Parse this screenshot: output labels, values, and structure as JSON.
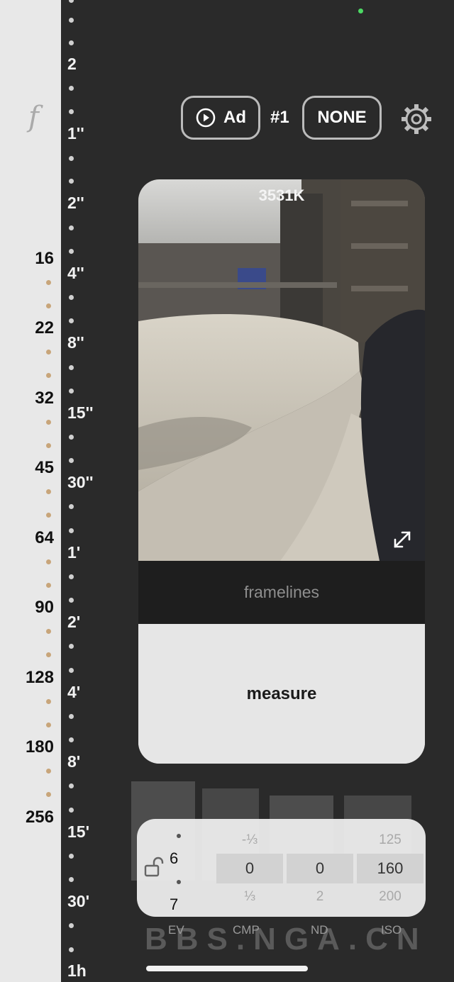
{
  "aperture": {
    "symbol": "f",
    "values": [
      "16",
      "22",
      "32",
      "45",
      "64",
      "90",
      "128",
      "180",
      "256"
    ]
  },
  "shutter": {
    "values": [
      "2",
      "1''",
      "2''",
      "4''",
      "8''",
      "15''",
      "30''",
      "1'",
      "2'",
      "4'",
      "8'",
      "15'",
      "30'",
      "1h"
    ]
  },
  "toolbar": {
    "ad_label": "Ad",
    "shot_number": "#1",
    "filter_label": "NONE"
  },
  "preview": {
    "white_balance": "3531K",
    "framelines_label": "framelines",
    "measure_label": "measure"
  },
  "exposure": {
    "ev_values": [
      "6",
      "7"
    ],
    "columns": [
      {
        "label": "CMP",
        "prev": "-⅓",
        "current": "0",
        "next": "⅓"
      },
      {
        "label": "ND",
        "prev": "",
        "current": "0",
        "next": "2"
      },
      {
        "label": "ISO",
        "prev": "125",
        "current": "160",
        "next": "200"
      }
    ],
    "ev_label": "EV"
  },
  "watermark": "BBS.NGA.CN",
  "colors": {
    "background": "#2a2a2a",
    "aperture_strip": "#e8e8e8",
    "aperture_dot": "#c8a57a",
    "status_dot": "#4cd964"
  }
}
